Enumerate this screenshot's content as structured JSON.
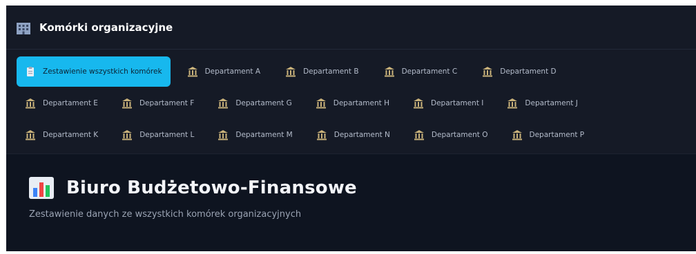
{
  "app": {
    "title": "Komórki organizacyjne",
    "icon": "building-icon"
  },
  "tabs": [
    {
      "label": "Zestawienie wszystkich komórek",
      "icon": "clipboard-icon",
      "active": true
    },
    {
      "label": "Departament A",
      "icon": "bank-icon"
    },
    {
      "label": "Departament B",
      "icon": "bank-icon"
    },
    {
      "label": "Departament C",
      "icon": "bank-icon"
    },
    {
      "label": "Departament D",
      "icon": "bank-icon"
    },
    {
      "label": "Departament E",
      "icon": "bank-icon"
    },
    {
      "label": "Departament F",
      "icon": "bank-icon"
    },
    {
      "label": "Departament G",
      "icon": "bank-icon"
    },
    {
      "label": "Departament H",
      "icon": "bank-icon"
    },
    {
      "label": "Departament I",
      "icon": "bank-icon"
    },
    {
      "label": "Departament J",
      "icon": "bank-icon"
    },
    {
      "label": "Departament K",
      "icon": "bank-icon"
    },
    {
      "label": "Departament L",
      "icon": "bank-icon"
    },
    {
      "label": "Departament M",
      "icon": "bank-icon"
    },
    {
      "label": "Departament N",
      "icon": "bank-icon"
    },
    {
      "label": "Departament O",
      "icon": "bank-icon"
    },
    {
      "label": "Departament P",
      "icon": "bank-icon"
    }
  ],
  "page": {
    "title": "Biuro Budżetowo-Finansowe",
    "title_icon": "bar-chart-icon",
    "subtitle": "Zestawienie danych ze wszystkich komórek organizacyjnych"
  },
  "colors": {
    "accent": "#17b8ee",
    "background": "#0e1420",
    "panel": "#151a26"
  }
}
